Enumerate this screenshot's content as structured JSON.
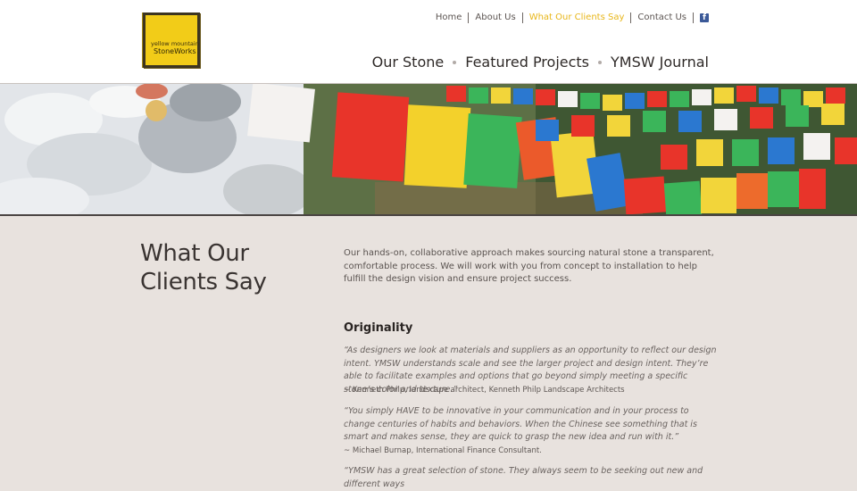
{
  "logo": {
    "line1": "yellow mountain",
    "line2": "StoneWorks",
    "color": "#f2cc18"
  },
  "top_nav": {
    "items": [
      {
        "label": "Home",
        "active": false
      },
      {
        "label": "About Us",
        "active": false
      },
      {
        "label": "What Our Clients Say",
        "active": true
      },
      {
        "label": "Contact Us",
        "active": false
      }
    ],
    "facebook_icon": "facebook-icon",
    "active_color": "#e8b619"
  },
  "main_nav": {
    "items": [
      "Our Stone",
      "Featured Projects",
      "YMSW Journal"
    ]
  },
  "page": {
    "title_line1": "What Our",
    "title_line2": "Clients Say",
    "intro": "Our hands-on, collaborative approach makes sourcing natural stone a transparent, comfortable process. We will work with you from concept to installation to help fulfill the design vision and ensure project success."
  },
  "section": {
    "heading": "Originality",
    "testimonials": [
      {
        "quote": "“As designers we look at materials and suppliers as an opportunity to reflect our design intent. YMSW understands scale and see the larger project and design intent. They’re able to facilitate examples and options that go beyond simply meeting a specific stone’s color and texture.”",
        "author": "~ Kenneth Philp, landscape architect, Kenneth Philp Landscape Architects"
      },
      {
        "quote": "“You simply HAVE to be innovative in your communication and in your process to change centuries of habits and behaviors. When the Chinese see something that is smart and makes sense, they are quick to grasp the new idea and run with it.”",
        "author": "~ Michael Burnap, International Finance Consultant."
      },
      {
        "quote": "“YMSW has a great selection of stone. They always seem to be seeking out new and different ways",
        "author": ""
      }
    ]
  }
}
